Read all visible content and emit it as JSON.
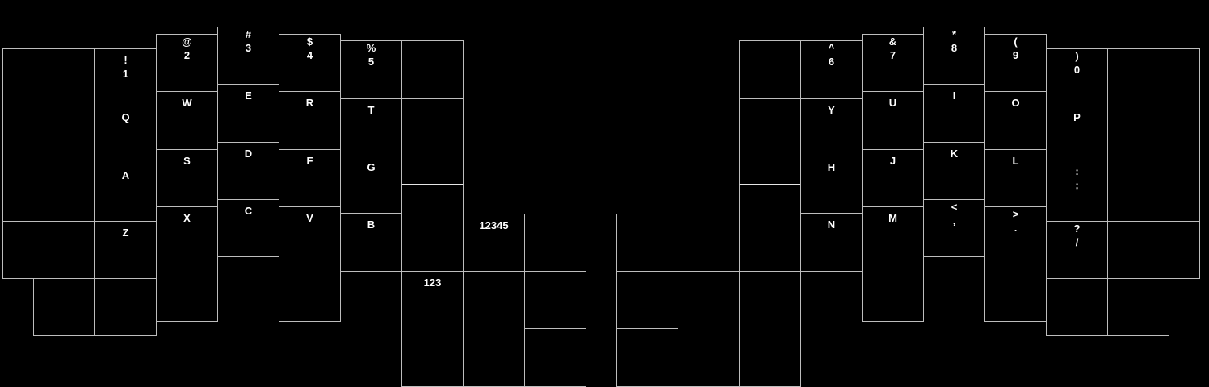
{
  "keyboard": {
    "name": "split-ergonomic-layout",
    "colors": {
      "background": "#000000",
      "key_border": "#bdbdbd",
      "legend": "#ffffff"
    },
    "left": {
      "outer_col": [
        "",
        "",
        "",
        "",
        ""
      ],
      "pinky_col": [
        "!\n1",
        "Q",
        "A",
        "Z",
        ""
      ],
      "ring_col": [
        "@\n2",
        "W",
        "S",
        "X",
        ""
      ],
      "middle_col": [
        "#\n3",
        "E",
        "D",
        "C",
        ""
      ],
      "index_col": [
        "$\n4",
        "R",
        "F",
        "V",
        ""
      ],
      "inner_col": [
        "%\n5",
        "T",
        "G",
        "B"
      ],
      "extra_col": [
        "",
        "",
        ""
      ],
      "thumb": [
        "12345",
        "",
        "123",
        "",
        "",
        ""
      ]
    },
    "right": {
      "extra_col": [
        "",
        "",
        ""
      ],
      "inner_col": [
        "^\n6",
        "Y",
        "H",
        "N"
      ],
      "index_col": [
        "&\n7",
        "U",
        "J",
        "M",
        ""
      ],
      "middle_col": [
        "*\n8",
        "I",
        "K",
        "<\n,",
        ""
      ],
      "ring_col": [
        "(\n9",
        "O",
        "L",
        ">\n.",
        ""
      ],
      "pinky_col": [
        ")\n0",
        "P",
        ":\n;",
        "?\n/",
        ""
      ],
      "outer_col": [
        "",
        "",
        "",
        "",
        ""
      ],
      "thumb": [
        "",
        "",
        "",
        "",
        "",
        ""
      ]
    }
  }
}
